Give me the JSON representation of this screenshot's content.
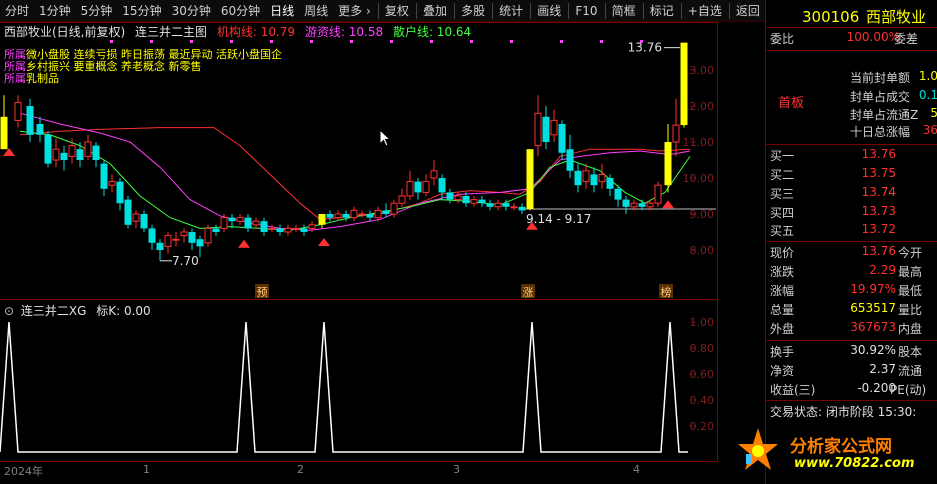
{
  "toolbar": {
    "items": [
      "分时",
      "1分钟",
      "5分钟",
      "15分钟",
      "30分钟",
      "60分钟",
      "日线",
      "周线",
      "更多 ›"
    ],
    "actions": [
      "复权",
      "叠加",
      "多股",
      "统计",
      "画线",
      "F10",
      "简框",
      "标记",
      "+自选",
      "返回"
    ]
  },
  "main": {
    "title": "西部牧业(日线,前复权)",
    "indicator_name": "连三并二主图",
    "line1_label": "机构线: 10.79",
    "line2_label": "游资线: 10.58",
    "line3_label": "散户线: 10.64",
    "concepts_label": "所属",
    "concepts": [
      "微小盘股 连续亏损 昨日振荡 最近异动 活跃小盘国企",
      "乡村振兴 要重概念 养老概念 新零售",
      "乳制品"
    ],
    "price_high_annot": "13.76",
    "price_low_annot": "7.70",
    "range_annot": "9.14 - 9.17",
    "y_ticks": [
      "13.00",
      "12.00",
      "11.00",
      "10.00",
      "9.00",
      "8.00"
    ],
    "markers": [
      "预",
      "涨",
      "榜"
    ]
  },
  "sub": {
    "title": "连三并二XG",
    "value_label": "标K: 0.00",
    "y_ticks": [
      "1.00",
      "0.80",
      "0.60",
      "0.40",
      "0.20"
    ]
  },
  "x_axis": {
    "labels": [
      "2024年",
      "1",
      "2",
      "3",
      "4"
    ]
  },
  "quote": {
    "code": "300106",
    "name": "西部牧业",
    "weibi_label": "委比",
    "weibi_value": "100.00%",
    "weicha_label": "委差",
    "status_badge": "首板",
    "stats": [
      {
        "k": "当前封单额",
        "v": "1.0"
      },
      {
        "k": "封单占成交",
        "v": "0.1"
      },
      {
        "k": "封单占流通Z",
        "v": "5"
      },
      {
        "k": "十日总涨幅",
        "v": "36"
      }
    ],
    "orders": [
      {
        "k": "买一",
        "v": "13.76"
      },
      {
        "k": "买二",
        "v": "13.75"
      },
      {
        "k": "买三",
        "v": "13.74"
      },
      {
        "k": "买四",
        "v": "13.73"
      },
      {
        "k": "买五",
        "v": "13.72"
      }
    ],
    "details": [
      {
        "k": "现价",
        "v": "13.76",
        "k2": "今开"
      },
      {
        "k": "涨跌",
        "v": "2.29",
        "k2": "最高"
      },
      {
        "k": "涨幅",
        "v": "19.97%",
        "k2": "最低"
      },
      {
        "k": "总量",
        "v": "653517",
        "k2": "量比"
      },
      {
        "k": "外盘",
        "v": "367673",
        "k2": "内盘"
      }
    ],
    "details2": [
      {
        "k": "换手",
        "v": "30.92%",
        "k2": "股本"
      },
      {
        "k": "净资",
        "v": "2.37",
        "k2": "流通"
      },
      {
        "k": "收益(三)",
        "v": "-0.200",
        "k2": "PE(动)"
      }
    ],
    "trade_status": "交易状态: 闭市阶段 15:30:",
    "logo_text": "分析家公式网",
    "logo_url": "www.70822.com"
  },
  "colors": {
    "up": "#ff3030",
    "down": "#00e0e0",
    "ma_red": "#ff3030",
    "ma_magenta": "#ff40ff",
    "ma_green": "#40ff40",
    "limit_up": "#ffff00",
    "line_white": "#ffffff",
    "logo_orange": "#ff8000"
  }
}
